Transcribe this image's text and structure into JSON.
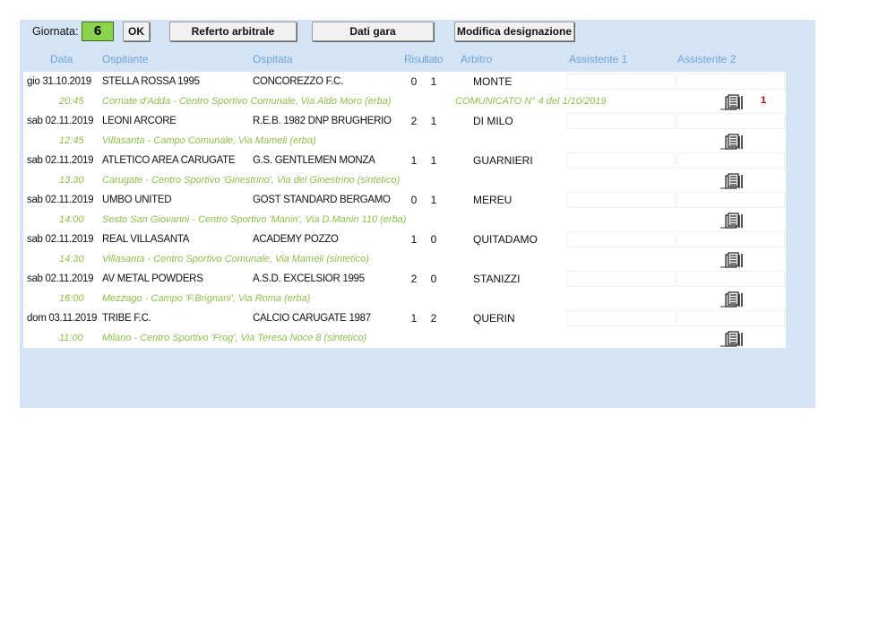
{
  "toolbar": {
    "giornata_label": "Giornata:",
    "giornata_value": "6",
    "ok_label": "OK",
    "referto_label": "Referto arbitrale",
    "dati_label": "Dati gara",
    "modifica_label": "Modifica designazione"
  },
  "headers": {
    "data": "Data",
    "ospitante": "Ospitante",
    "ospitata": "Ospitata",
    "risultato": "Risultato",
    "arbitro": "Arbitro",
    "assistente1": "Assistente 1",
    "assistente2": "Assistente 2"
  },
  "matches": [
    {
      "date": "gio 31.10.2019",
      "home": "STELLA ROSSA 1995",
      "away": "CONCOREZZO F.C.",
      "score_home": "0",
      "score_away": "1",
      "referee": "MONTE",
      "time": "20:45",
      "venue": "Cornate d'Adda - Centro Sportivo Comunale, Via Aldo Moro (erba)",
      "note": "COMUNICATO N° 4 del  1/10/2019",
      "flag": "1"
    },
    {
      "date": "sab 02.11.2019",
      "home": "LEONI ARCORE",
      "away": "R.E.B. 1982 DNP BRUGHERIO",
      "score_home": "2",
      "score_away": "1",
      "referee": "DI MILO",
      "time": "12:45",
      "venue": "Villasanta - Campo Comunale, Via Mameli (erba)",
      "note": "",
      "flag": ""
    },
    {
      "date": "sab 02.11.2019",
      "home": "ATLETICO AREA CARUGATE",
      "away": "G.S. GENTLEMEN MONZA",
      "score_home": "1",
      "score_away": "1",
      "referee": "GUARNIERI",
      "time": "13:30",
      "venue": "Carugate - Centro Sportivo 'Ginestrino', Via del Ginestrino (sintetico)",
      "note": "",
      "flag": ""
    },
    {
      "date": "sab 02.11.2019",
      "home": "UMBO UNITED",
      "away": "GOST STANDARD BERGAMO",
      "score_home": "0",
      "score_away": "1",
      "referee": "MEREU",
      "time": "14:00",
      "venue": "Sesto San Giovanni - Centro Sportivo 'Manin', Via D.Manin 110 (erba)",
      "note": "",
      "flag": ""
    },
    {
      "date": "sab 02.11.2019",
      "home": "REAL VILLASANTA",
      "away": "ACADEMY POZZO",
      "score_home": "1",
      "score_away": "0",
      "referee": "QUITADAMO",
      "time": "14:30",
      "venue": "Villasanta - Centro Sportivo Comunale, Via Mameli (sintetico)",
      "note": "",
      "flag": ""
    },
    {
      "date": "sab 02.11.2019",
      "home": "AV METAL POWDERS",
      "away": "A.S.D. EXCELSIOR 1995",
      "score_home": "2",
      "score_away": "0",
      "referee": "STANIZZI",
      "time": "16:00",
      "venue": "Mezzago - Campo 'F.Brignani', Via Roma (erba)",
      "note": "",
      "flag": ""
    },
    {
      "date": "dom 03.11.2019",
      "home": "TRIBE F.C.",
      "away": "CALCIO CARUGATE 1987",
      "score_home": "1",
      "score_away": "2",
      "referee": "QUERIN",
      "time": "11:00",
      "venue": "Milano - Centro Sportivo 'Frog', Via Teresa Noce 8 (sintetico)",
      "note": "",
      "flag": ""
    }
  ],
  "icons": {
    "document": "document-icon"
  },
  "colors": {
    "panel": "#d5e4f4",
    "header_text": "#6ca3dc",
    "venue_text": "#8cbf4a",
    "giornata_box": "#8bd34a",
    "flag": "#c00000"
  }
}
